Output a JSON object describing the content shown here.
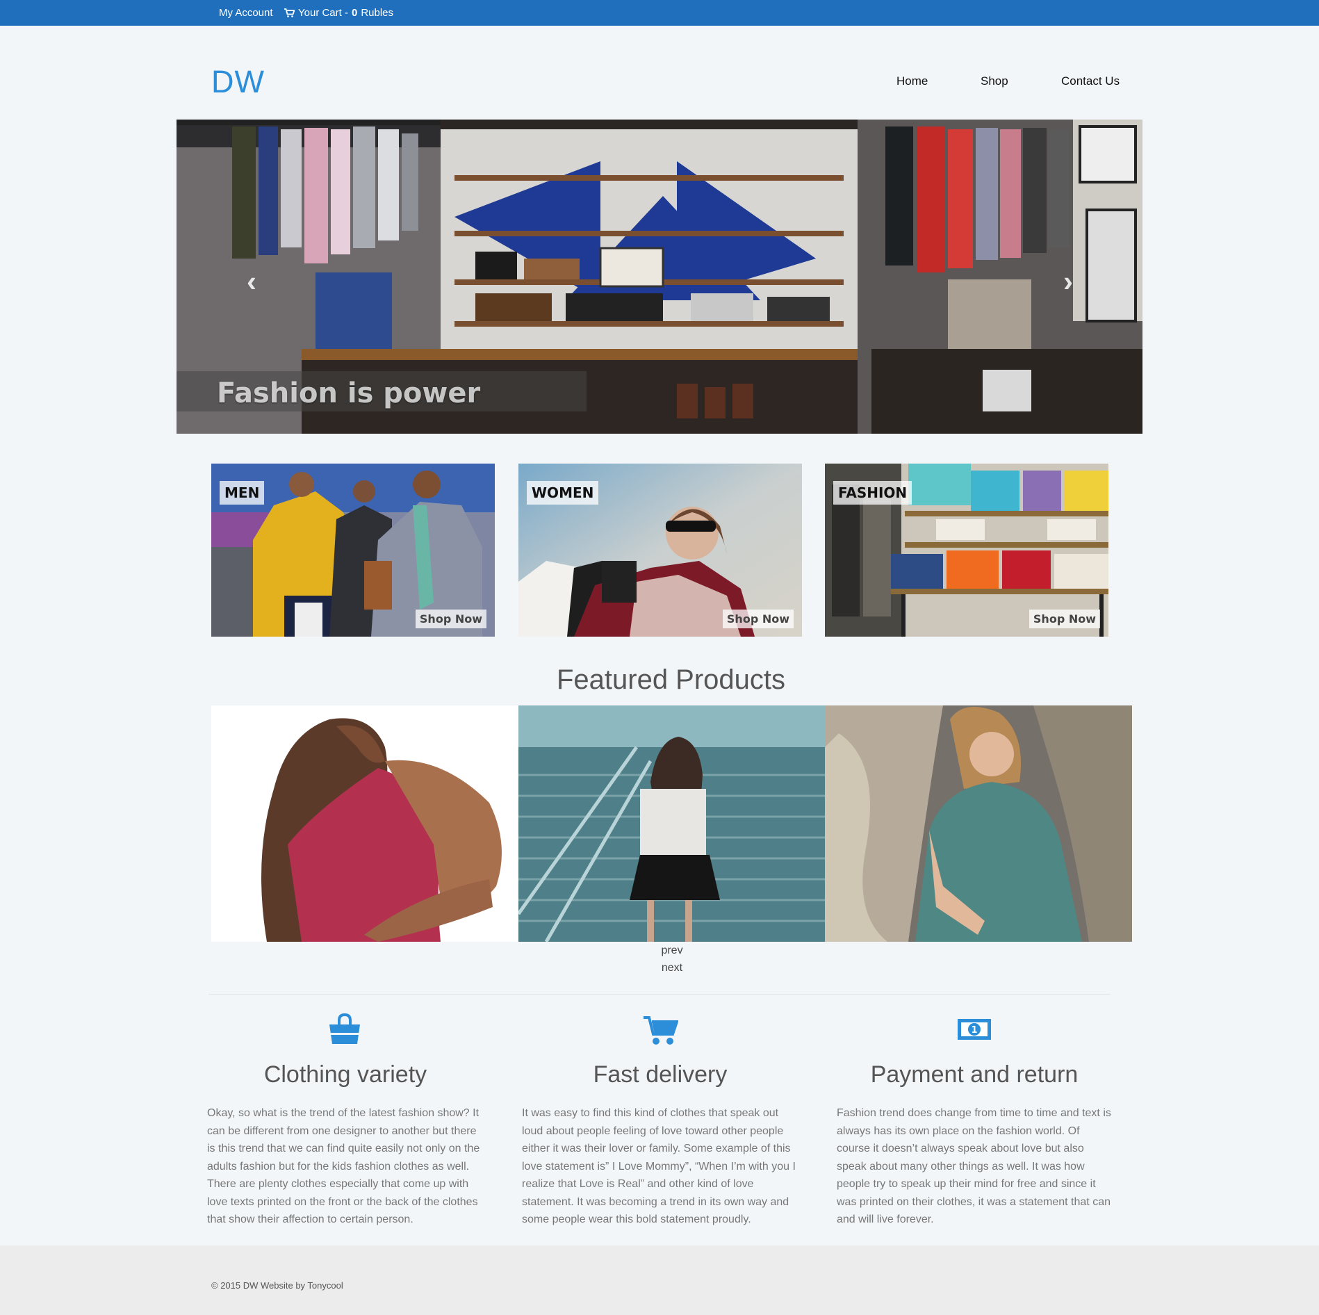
{
  "topbar": {
    "account_label": "My Account",
    "cart_prefix": "Your Cart - ",
    "cart_count": "0",
    "cart_suffix": " Rubles",
    "icon": "shopping-cart-icon",
    "background_color": "#1f6fbd"
  },
  "header": {
    "logo": "DW",
    "logo_color": "#2c8ed8",
    "nav": {
      "home": "Home",
      "shop": "Shop",
      "contact": "Contact Us"
    }
  },
  "hero": {
    "caption": "Fashion is power",
    "prev_glyph": "‹",
    "next_glyph": "›"
  },
  "categories": [
    {
      "label": "MEN",
      "cta": "Shop Now"
    },
    {
      "label": "WOMEN",
      "cta": "Shop Now"
    },
    {
      "label": "FASHION",
      "cta": "Shop Now"
    }
  ],
  "featured": {
    "title": "Featured Products",
    "prev": "prev",
    "next": "next"
  },
  "features": [
    {
      "icon": "shopping-bag-icon",
      "title": "Clothing variety",
      "text": "Okay, so what is the trend of the latest fashion show? It can be different from one designer to another but there is this trend that we can find quite easily not only on the adults fashion but for the kids fashion clothes as well. There are plenty clothes especially that come up with love texts printed on the front or the back of the clothes that show their affection to certain person."
    },
    {
      "icon": "shopping-cart-icon",
      "title": "Fast delivery",
      "text": "It was easy to find this kind of clothes that speak out loud about people feeling of love toward other people either it was their lover or family. Some example of this love statement is” I Love Mommy”, “When I’m with you I realize that Love is Real” and other kind of love statement. It was becoming a trend in its own way and some people wear this bold statement proudly."
    },
    {
      "icon": "money-bill-icon",
      "title": "Payment and return",
      "text": "Fashion trend does change from time to time and text is always has its own place on the fashion world. Of course it doesn’t always speak about love but also speak about many other things as well. It was how people try to speak up their mind for free and since it was printed on their clothes, it was a statement that can and will live forever."
    }
  ],
  "footer": {
    "text": "© 2015 DW Website by Tonycool"
  },
  "colors": {
    "accent": "#2c8ed8",
    "page_background": "#f3f6f9",
    "footer_background": "#ececed"
  }
}
